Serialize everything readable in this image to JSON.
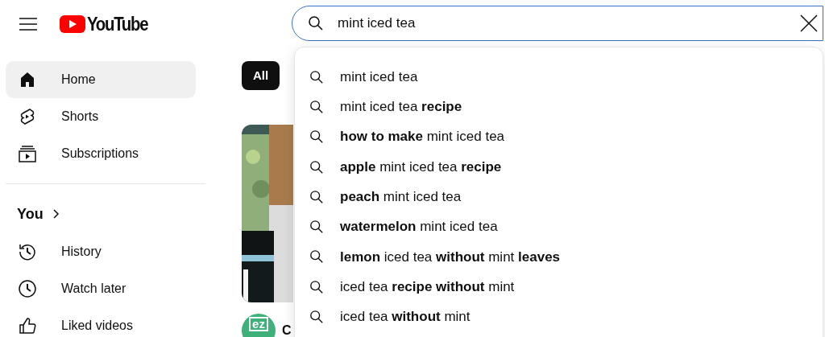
{
  "header": {
    "logo_text": "YouTube",
    "search": {
      "value": "mint iced tea"
    }
  },
  "sidebar": {
    "items": [
      {
        "label": "Home",
        "selected": true
      },
      {
        "label": "Shorts",
        "selected": false
      },
      {
        "label": "Subscriptions",
        "selected": false
      }
    ],
    "you_heading": "You",
    "you_items": [
      {
        "label": "History",
        "selected": false
      },
      {
        "label": "Watch later",
        "selected": false
      },
      {
        "label": "Liked videos",
        "selected": false
      }
    ]
  },
  "chips": [
    {
      "label": "All",
      "selected": true
    }
  ],
  "video": {
    "avatar_text": "ez",
    "title": "C"
  },
  "suggestions": [
    "mint iced tea",
    "mint iced tea **recipe**",
    "**how to make** mint iced tea",
    "**apple** mint iced tea **recipe**",
    "**peach** mint iced tea",
    "**watermelon** mint iced tea",
    "**lemon** iced tea **without** mint **leaves**",
    "iced tea **recipe without** mint",
    "iced tea **without** mint"
  ]
}
